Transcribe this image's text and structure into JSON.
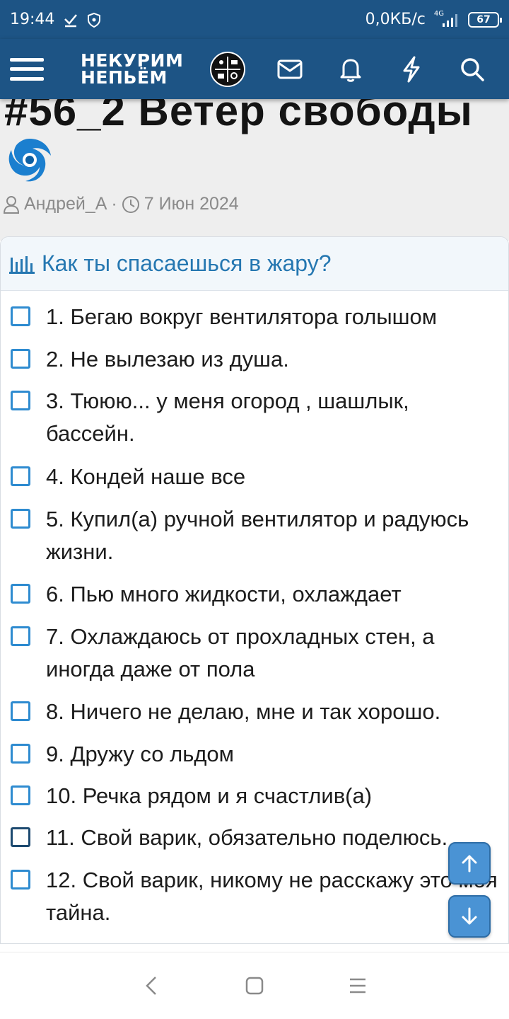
{
  "status_bar": {
    "time": "19:44",
    "net_speed": "0,0КБ/с",
    "network_gen": "4G",
    "battery": "67",
    "icons": [
      "check-icon",
      "shield-icon",
      "signal-icon",
      "battery-icon"
    ]
  },
  "header": {
    "logo_line1": "НЕКУРИМ",
    "logo_line2": "НЕПЬЁМ",
    "icons": [
      "menu-icon",
      "mail-icon",
      "bell-icon",
      "lightning-icon",
      "search-icon"
    ],
    "background": "#1d5485"
  },
  "thread": {
    "title": "#56_2 Ветер свободы",
    "author": "Андрей_А",
    "separator": "·",
    "date": "7 Июн 2024"
  },
  "poll": {
    "question": "Как ты спасаешься в жару?",
    "options": [
      {
        "label": "1. Бегаю вокруг вентилятора голышом"
      },
      {
        "label": "2. Не вылезаю из душа."
      },
      {
        "label": "3. Тююю... у меня огород , шашлык, бассейн."
      },
      {
        "label": "4. Кондей наше все"
      },
      {
        "label": "5. Купил(а) ручной вентилятор и радуюсь жизни."
      },
      {
        "label": "6. Пью много жидкости, охлаждает"
      },
      {
        "label": "7. Охлаждаюсь от прохладных стен, а иногда даже от пола"
      },
      {
        "label": "8. Ничего не делаю, мне и так хорошо."
      },
      {
        "label": "9. Дружу со льдом"
      },
      {
        "label": "10. Речка рядом и я счастлив(а)"
      },
      {
        "label": "11. Свой варик, обязательно поделюсь."
      },
      {
        "label": "12. Свой варик, никому не расскажу это моя тайна."
      }
    ],
    "accent": "#2577b1"
  },
  "scroll_buttons": {
    "up": "arrow-up-icon",
    "down": "arrow-down-icon"
  },
  "nav": {
    "icons": [
      "back-icon",
      "home-icon",
      "recents-icon"
    ]
  }
}
